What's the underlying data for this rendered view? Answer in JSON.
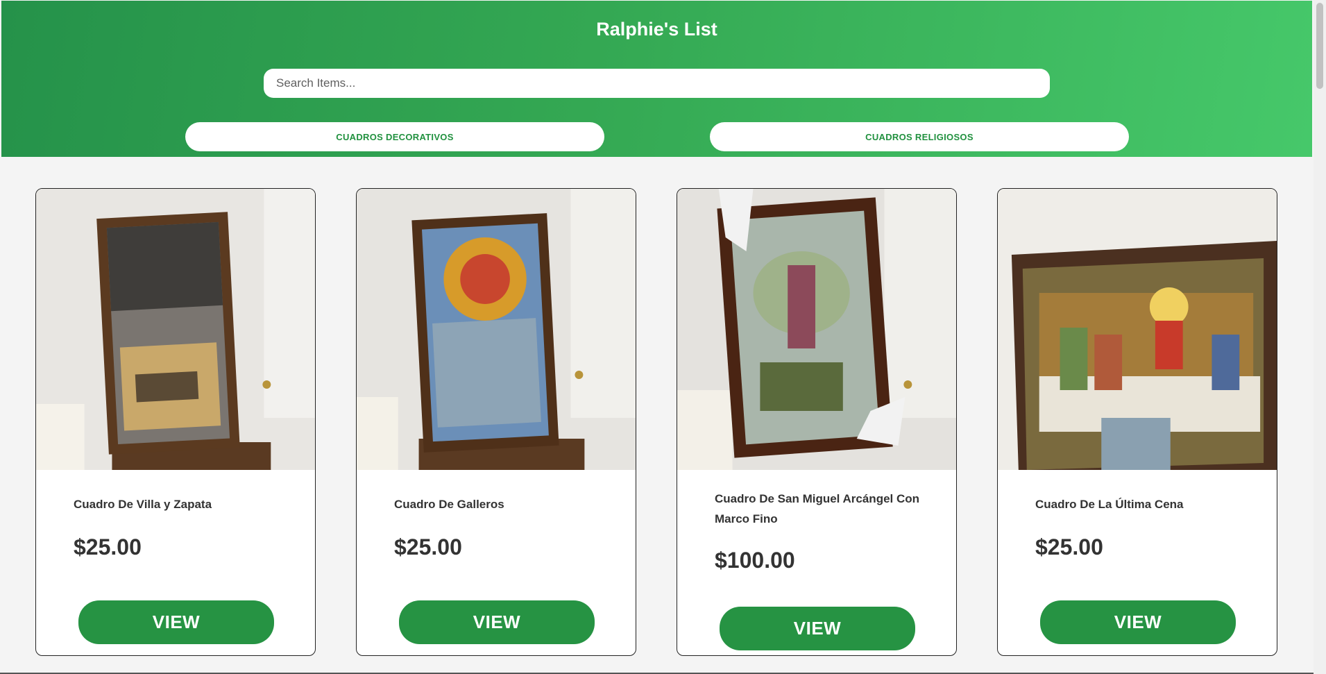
{
  "header": {
    "title": "Ralphie's List",
    "search_placeholder": "Search Items...",
    "categories": [
      "CUADROS DECORATIVOS",
      "CUADROS RELIGIOSOS"
    ]
  },
  "products": [
    {
      "name": "Cuadro De Villa y Zapata",
      "price": "$25.00",
      "button": "VIEW",
      "image": "villa-zapata-painting"
    },
    {
      "name": "Cuadro De Galleros",
      "price": "$25.00",
      "button": "VIEW",
      "image": "galleros-painting"
    },
    {
      "name": "Cuadro De San Miguel Arcángel Con Marco Fino",
      "price": "$100.00",
      "button": "VIEW",
      "image": "san-miguel-painting"
    },
    {
      "name": "Cuadro De La Última Cena",
      "price": "$25.00",
      "button": "VIEW",
      "image": "ultima-cena-painting"
    }
  ],
  "colors": {
    "header_gradient_start": "#25924a",
    "header_gradient_end": "#46c86a",
    "accent_green": "#269343",
    "category_text": "#21913f"
  }
}
